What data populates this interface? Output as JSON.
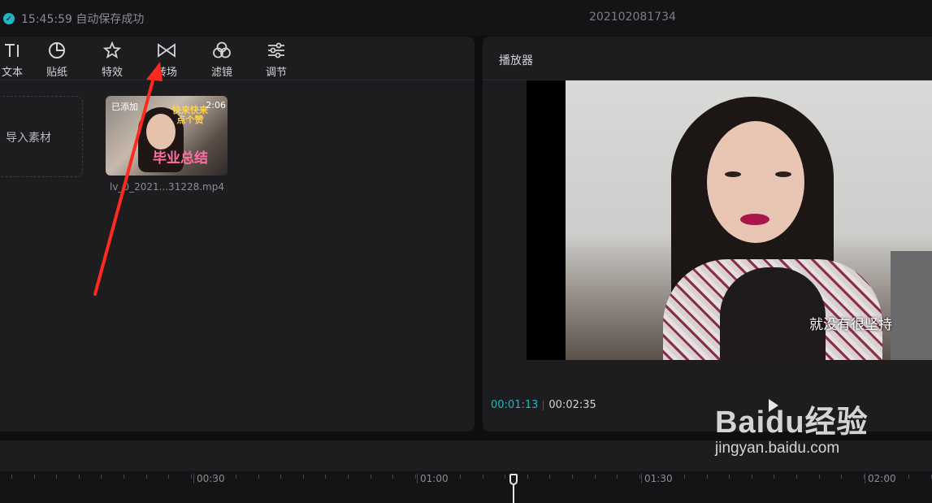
{
  "topbar": {
    "save_status": "15:45:59 自动保存成功",
    "project_name": "202102081734"
  },
  "library": {
    "tabs": [
      {
        "label": "文本",
        "icon": "text-icon"
      },
      {
        "label": "贴纸",
        "icon": "sticker-icon"
      },
      {
        "label": "特效",
        "icon": "effects-icon"
      },
      {
        "label": "转场",
        "icon": "transition-icon"
      },
      {
        "label": "滤镜",
        "icon": "filter-icon"
      },
      {
        "label": "调节",
        "icon": "adjust-icon"
      }
    ],
    "import_label": "导入素材",
    "media": {
      "added_badge": "已添加",
      "duration": "2:06",
      "overlay_top": "快来快来点个赞",
      "overlay_main": "毕业总结",
      "filename": "lv_0_2021...31228.mp4"
    }
  },
  "player": {
    "title": "播放器",
    "subtitle": "就没有很坚持",
    "current_time": "00:01:13",
    "total_time": "00:02:35"
  },
  "timeline": {
    "ruler_labels": [
      "00:30",
      "01:00",
      "01:30",
      "02:00"
    ]
  },
  "watermark": {
    "logo": "Baidu经验",
    "url": "jingyan.baidu.com"
  },
  "colors": {
    "accent": "#1fb6c5",
    "panel": "#1d1d20",
    "background": "#0f0f11",
    "annotation_arrow": "#ff2a1f"
  }
}
